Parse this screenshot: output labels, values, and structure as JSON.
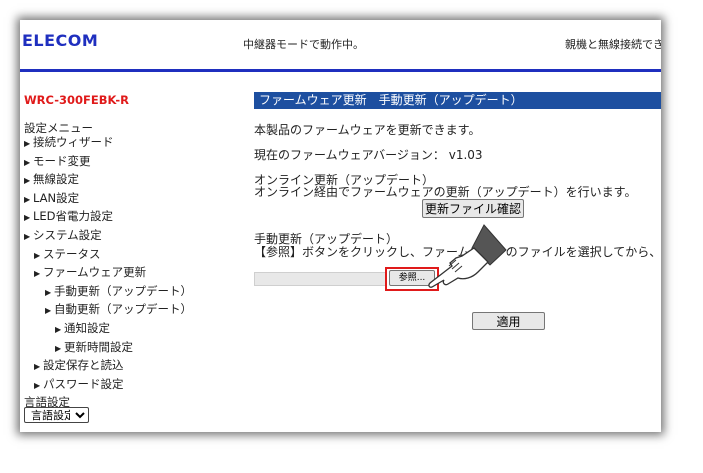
{
  "header": {
    "logo": "ELECOM",
    "status_mode": "中継器モードで動作中。",
    "status_connection": "親機と無線接続でき"
  },
  "sidebar": {
    "model": "WRC-300FEBK-R",
    "menu_title": "設定メニュー",
    "items": [
      {
        "label": "接続ウィザード",
        "level": 0
      },
      {
        "label": "モード変更",
        "level": 0
      },
      {
        "label": "無線設定",
        "level": 0
      },
      {
        "label": "LAN設定",
        "level": 0
      },
      {
        "label": "LED省電力設定",
        "level": 0
      },
      {
        "label": "システム設定",
        "level": 0
      },
      {
        "label": "ステータス",
        "level": 1
      },
      {
        "label": "ファームウェア更新",
        "level": 1
      },
      {
        "label": "手動更新（アップデート）",
        "level": 2
      },
      {
        "label": "自動更新（アップデート）",
        "level": 2
      },
      {
        "label": "通知設定",
        "level": 3
      },
      {
        "label": "更新時間設定",
        "level": 3
      },
      {
        "label": "設定保存と読込",
        "level": 1
      },
      {
        "label": "パスワード設定",
        "level": 1
      }
    ],
    "language_label": "言語設定",
    "language_select_value": "言語設定"
  },
  "main": {
    "section_title": "ファームウェア更新　手動更新（アップデート）",
    "intro": "本製品のファームウェアを更新できます。",
    "current_version": "現在のファームウェアバージョン： v1.03",
    "online_title": "オンライン更新（アップデート）",
    "online_desc": "オンライン経由でファームウェアの更新（アップデート）を行います。",
    "check_button": "更新ファイル確認",
    "manual_title": "手動更新（アップデート）",
    "manual_desc": "【参照】ボタンをクリックし、ファームウェアのファイルを選択してから、適",
    "browse_button": "参照...",
    "apply_button": "適用"
  },
  "colors": {
    "brand_blue": "#1f2fbf",
    "section_header_bg": "#1d4fa0",
    "model_red": "#e01a1a",
    "highlight_red": "#e01a1a"
  }
}
